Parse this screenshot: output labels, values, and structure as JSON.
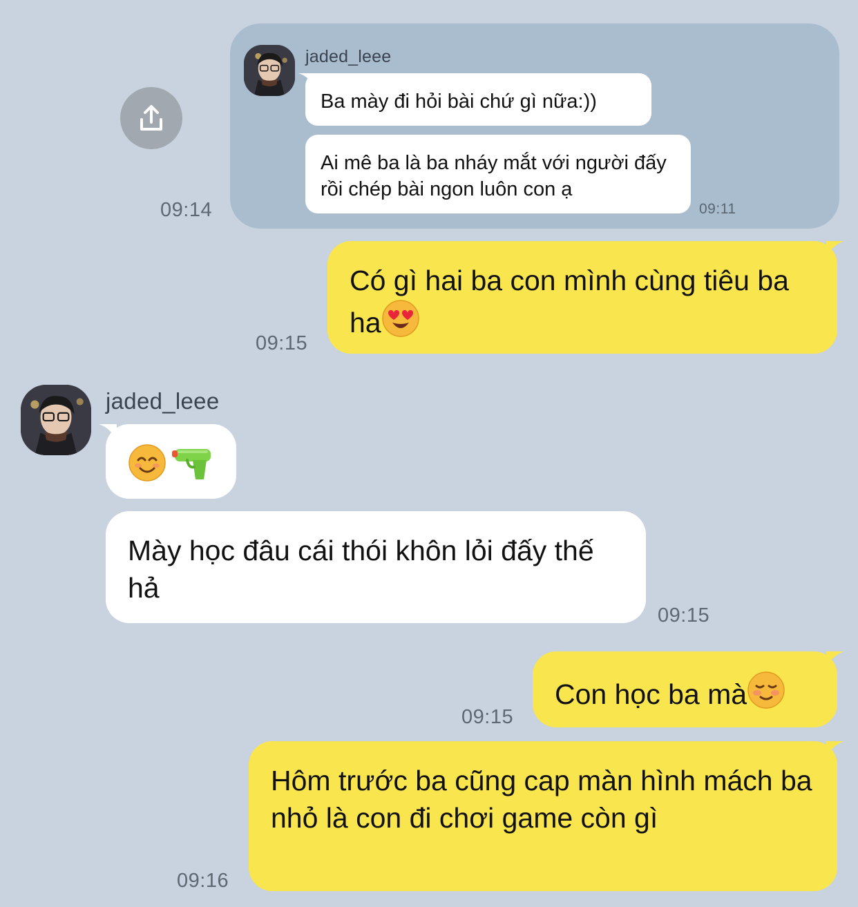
{
  "forwarded": {
    "sender": "jaded_leee",
    "messages": [
      {
        "text": "Ba mày đi hỏi bài chứ gì nữa:))"
      },
      {
        "text": "Ai mê ba là ba nháy mắt với người đấy rồi chép bài ngon luôn con ạ"
      }
    ],
    "inner_time": "09:11",
    "outer_time": "09:14",
    "share_icon": "share-upload-icon"
  },
  "messages": [
    {
      "side": "right",
      "text": "Có gì hai ba con mình cùng tiêu ba ha",
      "emoji": "heart-eyes-emoji",
      "time": "09:15"
    },
    {
      "side": "left",
      "sender": "jaded_leee",
      "emojis": [
        "smiling-face-emoji",
        "water-pistol-emoji"
      ]
    },
    {
      "side": "left",
      "text": "Mày học đâu cái thói khôn lỏi đấy thế hả",
      "time": "09:15"
    },
    {
      "side": "right",
      "text": "Con học ba mà",
      "emoji": "smiling-blush-emoji",
      "time": "09:15"
    },
    {
      "side": "right",
      "text": "Hôm trước ba cũng cap màn hình mách ba nhỏ là con đi chơi game còn gì",
      "time": "09:16"
    }
  ],
  "colors": {
    "background": "#c8d3df",
    "forward_card": "#a9bdcf",
    "incoming_bubble": "#ffffff",
    "outgoing_bubble": "#f9e54d"
  }
}
